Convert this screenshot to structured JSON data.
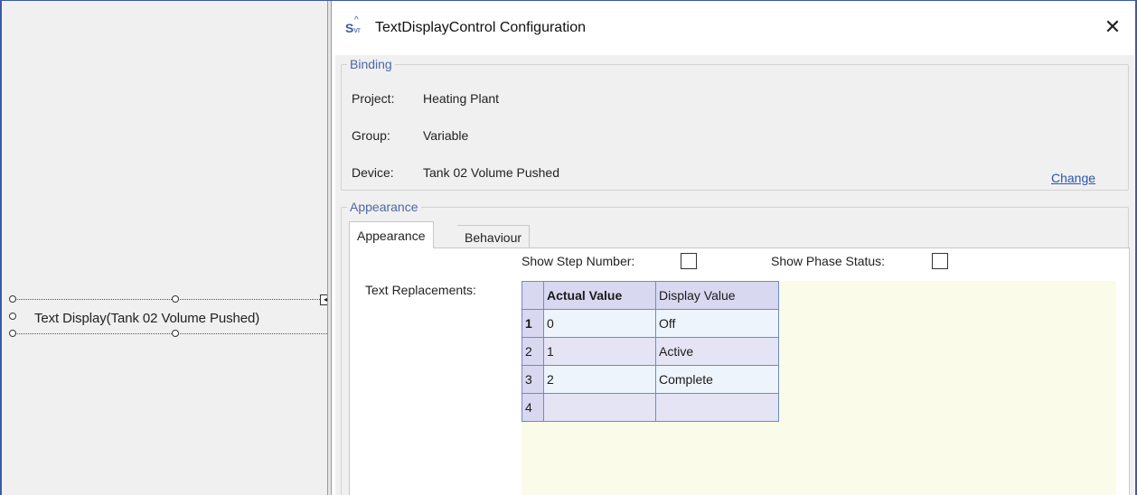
{
  "designer": {
    "control_label": "Text Display(Tank 02 Volume Pushed)"
  },
  "dialog": {
    "title": "TextDisplayControl Configuration",
    "close_glyph": "✕",
    "icon_text": "Svr"
  },
  "binding": {
    "legend": "Binding",
    "project_label": "Project:",
    "project_value": "Heating Plant",
    "group_label": "Group:",
    "group_value": "Variable",
    "device_label": "Device:",
    "device_value": "Tank 02 Volume Pushed",
    "change_link": "Change"
  },
  "appearance": {
    "legend": "Appearance",
    "tabs": [
      {
        "label": "Appearance",
        "active": true
      },
      {
        "label": "Behaviour",
        "active": false
      }
    ],
    "show_step_number_label": "Show Step Number:",
    "show_step_number_checked": false,
    "show_phase_status_label": "Show Phase Status:",
    "show_phase_status_checked": false,
    "text_replacements_label": "Text Replacements:",
    "grid": {
      "headers": [
        "Actual Value",
        "Display Value"
      ],
      "rows": [
        {
          "num": "1",
          "actual": "0",
          "display": "Off"
        },
        {
          "num": "2",
          "actual": "1",
          "display": "Active"
        },
        {
          "num": "3",
          "actual": "2",
          "display": "Complete"
        },
        {
          "num": "4",
          "actual": "",
          "display": ""
        }
      ]
    }
  },
  "colors": {
    "frame": "#3b5aa6",
    "link": "#2955b0",
    "legend": "#4a67a7",
    "grid_border": "#6b8cc7",
    "grid_background": "#fbfbea"
  }
}
